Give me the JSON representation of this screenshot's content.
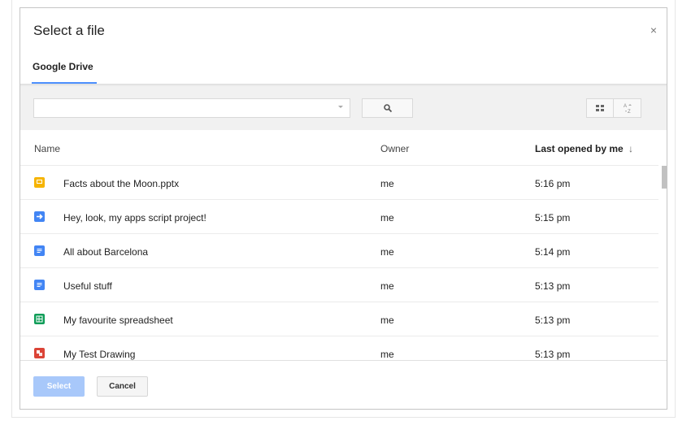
{
  "dialog": {
    "title": "Select a file",
    "close_glyph": "×",
    "tab_label": "Google Drive"
  },
  "toolbar": {
    "search_value": "",
    "search_placeholder": "",
    "search_icon": "search-icon",
    "grid_view_icon": "grid-view-icon",
    "sort_az_label": "A-Z"
  },
  "columns": {
    "name": "Name",
    "owner": "Owner",
    "last_opened": "Last opened by me",
    "sort_arrow": "↓"
  },
  "files": [
    {
      "name": "Facts about the Moon.pptx",
      "owner": "me",
      "time": "5:16 pm",
      "type": "slides",
      "color": "#f6b400"
    },
    {
      "name": "Hey, look, my apps script project!",
      "owner": "me",
      "time": "5:15 pm",
      "type": "script",
      "color": "#4285f4"
    },
    {
      "name": "All about Barcelona",
      "owner": "me",
      "time": "5:14 pm",
      "type": "docs",
      "color": "#4285f4"
    },
    {
      "name": "Useful stuff",
      "owner": "me",
      "time": "5:13 pm",
      "type": "docs",
      "color": "#4285f4"
    },
    {
      "name": "My favourite spreadsheet",
      "owner": "me",
      "time": "5:13 pm",
      "type": "sheets",
      "color": "#0f9d58"
    },
    {
      "name": "My Test Drawing",
      "owner": "me",
      "time": "5:13 pm",
      "type": "drawing",
      "color": "#db4437"
    }
  ],
  "footer": {
    "select_label": "Select",
    "cancel_label": "Cancel"
  },
  "colors": {
    "accent": "#4d90fe",
    "select_disabled": "#a8c8fa"
  }
}
